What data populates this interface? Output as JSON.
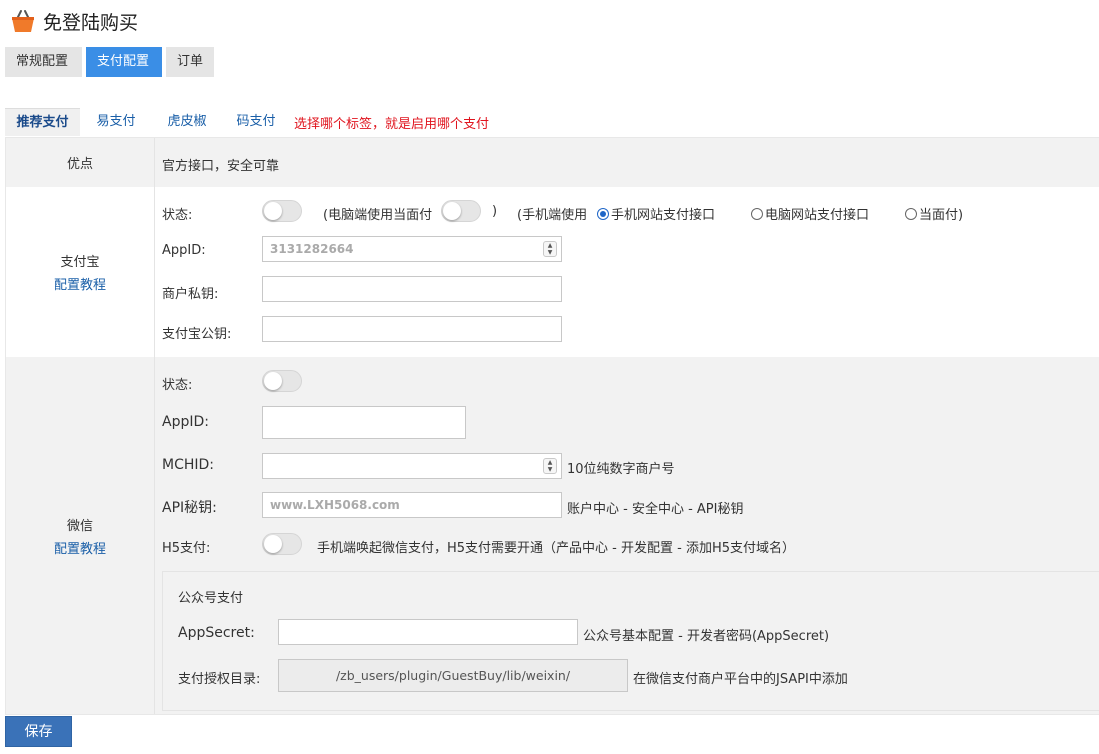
{
  "app": {
    "title": "免登陆购买",
    "icon": "shopping-basket-icon"
  },
  "top_tabs": [
    {
      "label": "常规配置",
      "active": false
    },
    {
      "label": "支付配置",
      "active": true
    },
    {
      "label": "订单",
      "active": false
    }
  ],
  "pay_tabs": [
    {
      "label": "推荐支付",
      "active": true
    },
    {
      "label": "易支付",
      "active": false
    },
    {
      "label": "虎皮椒",
      "active": false
    },
    {
      "label": "码支付",
      "active": false
    }
  ],
  "pay_tabs_hint": "选择哪个标签，就是启用哪个支付",
  "advantage": {
    "label": "优点",
    "text": "官方接口，安全可靠"
  },
  "alipay": {
    "label": "支付宝",
    "tutorial_link": "配置教程",
    "status_label": "状态:",
    "pc_face_pay_label": "(电脑端使用当面付",
    "close_paren": ")",
    "mobile_label": "(手机端使用",
    "radio_options": [
      "手机网站支付接口",
      "电脑网站支付接口",
      "当面付)"
    ],
    "radio_selected": 0,
    "appid_label": "AppID:",
    "appid_value": "3131282664",
    "private_key_label": "商户私钥:",
    "private_key_value": "",
    "public_key_label": "支付宝公钥:",
    "public_key_value": ""
  },
  "wechat": {
    "label": "微信",
    "tutorial_link": "配置教程",
    "status_label": "状态:",
    "appid_label": "AppID:",
    "appid_value": "",
    "mchid_label": "MCHID:",
    "mchid_value": "",
    "mchid_note": "10位纯数字商户号",
    "api_key_label": "API秘钥:",
    "api_key_value": "www.LXH5068.com",
    "api_key_note": "账户中心 - 安全中心 - API秘钥",
    "h5_label": "H5支付:",
    "h5_note": "手机端唤起微信支付，H5支付需要开通（产品中心 - 开发配置 - 添加H5支付域名）",
    "gzh": {
      "title": "公众号支付",
      "appsecret_label": "AppSecret:",
      "appsecret_value": "",
      "appsecret_note": "公众号基本配置 - 开发者密码(AppSecret)",
      "auth_dir_label": "支付授权目录:",
      "auth_dir_value": "/zb_users/plugin/GuestBuy/lib/weixin/",
      "auth_dir_note": "在微信支付商户平台中的JSAPI中添加"
    }
  },
  "save_label": "保存",
  "colors": {
    "primary": "#3a8ee6",
    "link": "#1a5fa8",
    "hint": "#e0141e",
    "save": "#3a72b8"
  }
}
